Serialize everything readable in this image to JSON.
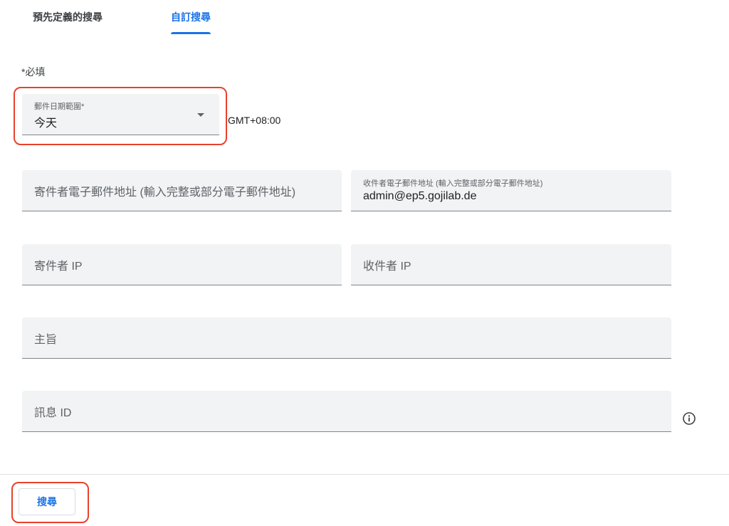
{
  "tabs": [
    {
      "label": "預先定義的搜尋",
      "active": false
    },
    {
      "label": "自訂搜尋",
      "active": true
    }
  ],
  "form": {
    "required_note": "*必填",
    "date_range": {
      "label": "郵件日期範圍*",
      "value": "今天",
      "timezone": "GMT+08:00"
    },
    "sender_email": {
      "placeholder": "寄件者電子郵件地址 (輸入完整或部分電子郵件地址)"
    },
    "recipient_email": {
      "label": "收件者電子郵件地址 (輸入完整或部分電子郵件地址)",
      "value": "admin@ep5.gojilab.de"
    },
    "sender_ip": {
      "placeholder": "寄件者 IP"
    },
    "recipient_ip": {
      "placeholder": "收件者 IP"
    },
    "subject": {
      "placeholder": "主旨"
    },
    "message_id": {
      "placeholder": "訊息 ID"
    }
  },
  "footer": {
    "search_label": "搜尋"
  },
  "icons": {
    "info": "info-icon",
    "dropdown": "caret-down-icon"
  },
  "colors": {
    "accent": "#1a73e8",
    "highlight": "#e8412c",
    "field_bg": "#f1f3f4"
  }
}
